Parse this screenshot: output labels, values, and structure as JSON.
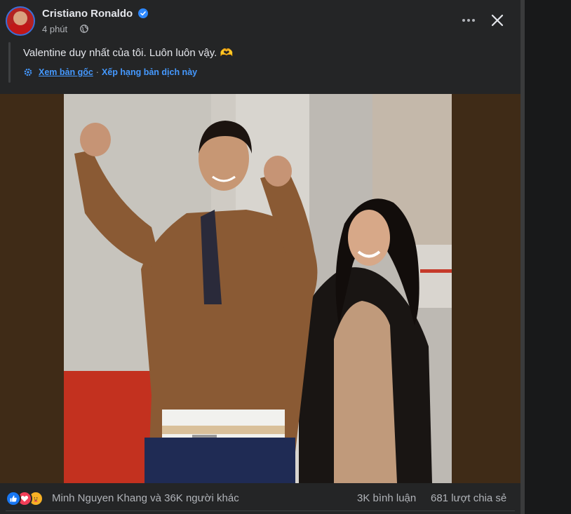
{
  "post": {
    "author": "Cristiano Ronaldo",
    "time": "4 phút",
    "text": "Valentine duy nhất của tôi. Luôn luôn vậy. 🫶",
    "translation": {
      "see_original": "Xem bản gốc",
      "separator": "·",
      "rate_translation": "Xếp hạng bản dịch này"
    }
  },
  "footer": {
    "reactions_text": "Minh Nguyen Khang và 36K người khác",
    "comments": "3K bình luận",
    "shares": "681 lượt chia sẻ"
  },
  "icons": {
    "verified": "verified-badge-icon",
    "globe": "globe-icon",
    "more": "more-options-icon",
    "close": "close-icon",
    "gear": "gear-icon",
    "like": "like-reaction-icon",
    "love": "love-reaction-icon",
    "care": "care-reaction-icon"
  },
  "colors": {
    "background": "#242526",
    "link": "#4599ff",
    "verified": "#2d88ff",
    "photo_letterbox": "#3f2b17"
  }
}
